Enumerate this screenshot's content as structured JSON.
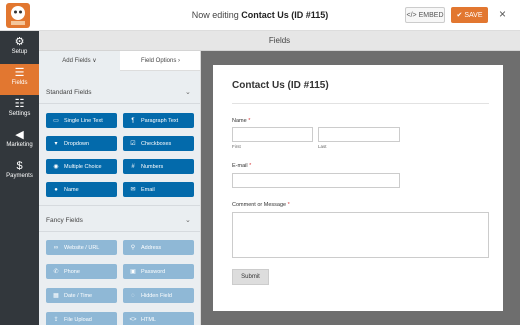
{
  "topbar": {
    "editing_prefix": "Now editing",
    "form_name": "Contact Us (ID #115)",
    "embed_label": "EMBED",
    "save_label": "SAVE",
    "close_glyph": "×"
  },
  "sidebar": {
    "items": [
      {
        "label": "Setup",
        "icon": "gear-icon",
        "glyph": "⚙"
      },
      {
        "label": "Fields",
        "icon": "fields-icon",
        "glyph": "☰"
      },
      {
        "label": "Settings",
        "icon": "sliders-icon",
        "glyph": "⚙"
      },
      {
        "label": "Marketing",
        "icon": "megaphone-icon",
        "glyph": "📢"
      },
      {
        "label": "Payments",
        "icon": "dollar-icon",
        "glyph": "$"
      }
    ]
  },
  "header": {
    "title": "Fields"
  },
  "panel": {
    "tabs": {
      "add_fields": "Add Fields ∨",
      "field_options": "Field Options ›"
    },
    "standard": {
      "title": "Standard Fields",
      "buttons": [
        "Single Line Text",
        "Paragraph Text",
        "Dropdown",
        "Checkboxes",
        "Multiple Choice",
        "Numbers",
        "Name",
        "Email"
      ]
    },
    "fancy": {
      "title": "Fancy Fields",
      "buttons": [
        "Website / URL",
        "Address",
        "Phone",
        "Password",
        "Date / Time",
        "Hidden Field",
        "File Upload",
        "HTML"
      ]
    }
  },
  "form": {
    "title": "Contact Us (ID #115)",
    "name_label": "Name",
    "first_sublabel": "First",
    "last_sublabel": "Last",
    "email_label": "E-mail",
    "message_label": "Comment or Message",
    "required_mark": "*",
    "submit_label": "Submit"
  },
  "colors": {
    "accent": "#e27730",
    "sidebar": "#32373c",
    "standard_button": "#036aab",
    "fancy_button": "#8fb8d6"
  }
}
